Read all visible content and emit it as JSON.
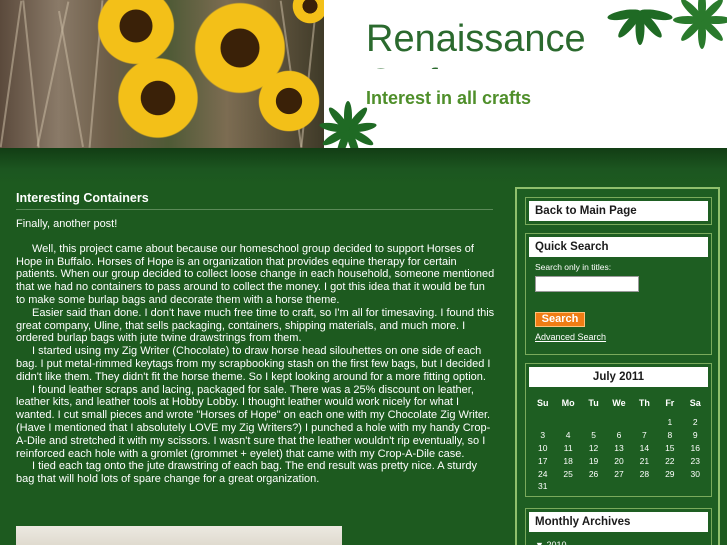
{
  "header": {
    "site_title": "Renaissance",
    "site_title_line2": "Crafts",
    "tagline": "Interest in all crafts"
  },
  "post": {
    "title": "Interesting Containers",
    "paragraphs": [
      "Finally, another post!",
      "Well, this project came about because our homeschool group decided to support Horses of Hope in Buffalo.  Horses of Hope is an organization that provides equine therapy for certain patients.  When our group decided to collect loose change in each household, someone mentioned that we had no containers to pass around to collect the money.  I got this idea that it would be fun to make some burlap bags and decorate them with a horse theme.",
      "Easier said than done.  I don't have much free time to craft, so I'm all for timesaving.  I found this great company, Uline, that sells packaging, containers, shipping materials, and much more.  I ordered burlap bags with jute twine drawstrings from them.",
      "I started using my Zig Writer (Chocolate) to draw horse head silouhettes on one side of each bag.  I put metal-rimmed keytags from my scrapbooking stash on the first few bags, but I decided I didn't like them.  They didn't fit the horse theme.  So I kept looking around for a more fitting option.",
      "I found leather scraps and lacing, packaged for sale.  There was a 25% discount on leather, leather kits, and leather tools at Hobby Lobby.  I thought leather would work nicely for what I wanted.  I cut small pieces and wrote \"Horses of Hope\" on each one with my Chocolate Zig Writer.  (Have I mentioned that I absolutely LOVE my Zig Writers?)  I punched a hole with my handy Crop-A-Dile and stretched it with my scissors.  I wasn't sure that the leather wouldn't rip eventually, so I reinforced each hole with a gromlet (grommet + eyelet) that came with my Crop-A-Dile case.",
      "I tied each tag onto the jute drawstring of each bag.  The end result was pretty nice.  A sturdy bag that will hold lots of spare change for a great organization."
    ]
  },
  "sidebar": {
    "back_label": "Back to Main Page",
    "search": {
      "title": "Quick Search",
      "label": "Search only in titles:",
      "input_value": "",
      "button_label": "Search",
      "advanced_label": "Advanced Search"
    },
    "calendar": {
      "title": "July 2011",
      "weekdays": [
        "Su",
        "Mo",
        "Tu",
        "We",
        "Th",
        "Fr",
        "Sa"
      ],
      "weeks": [
        [
          "",
          "",
          "",
          "",
          "",
          "1",
          "2"
        ],
        [
          "3",
          "4",
          "5",
          "6",
          "7",
          "8",
          "9"
        ],
        [
          "10",
          "11",
          "12",
          "13",
          "14",
          "15",
          "16"
        ],
        [
          "17",
          "18",
          "19",
          "20",
          "21",
          "22",
          "23"
        ],
        [
          "24",
          "25",
          "26",
          "27",
          "28",
          "29",
          "30"
        ],
        [
          "31",
          "",
          "",
          "",
          "",
          "",
          ""
        ]
      ]
    },
    "archives": {
      "title": "Monthly Archives",
      "first_item": "2010"
    }
  },
  "colors": {
    "background": "#1d5a1f",
    "title_green": "#2b6a2e",
    "tagline_green": "#4f8f2a",
    "search_button": "#f07d14",
    "sidebar_border": "#8fbf6c"
  },
  "icons": [
    "sunflower-photo",
    "leaf-cluster-icon",
    "triangle-down-icon"
  ]
}
